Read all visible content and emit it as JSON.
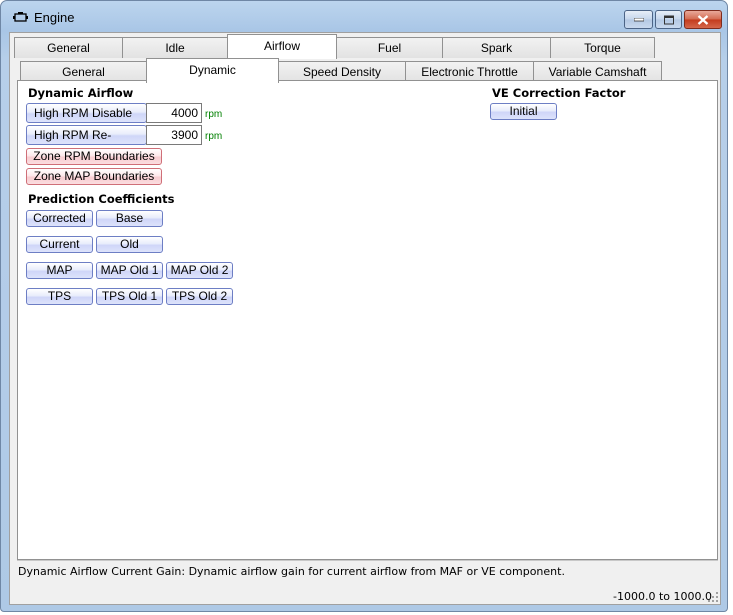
{
  "window": {
    "title": "Engine",
    "icon": "engine-icon"
  },
  "main_tabs": [
    {
      "label": "General",
      "selected": false
    },
    {
      "label": "Idle",
      "selected": false
    },
    {
      "label": "Airflow",
      "selected": true
    },
    {
      "label": "Fuel",
      "selected": false
    },
    {
      "label": "Spark",
      "selected": false
    },
    {
      "label": "Torque Management",
      "selected": false
    }
  ],
  "sub_tabs": [
    {
      "label": "General",
      "selected": false
    },
    {
      "label": "Dynamic",
      "selected": true
    },
    {
      "label": "Speed Density",
      "selected": false
    },
    {
      "label": "Electronic Throttle",
      "selected": false
    },
    {
      "label": "Variable Camshaft",
      "selected": false
    }
  ],
  "dynamic_airflow": {
    "title": "Dynamic Airflow",
    "high_rpm_disable": {
      "label": "High RPM Disable",
      "value": "4000",
      "unit": "rpm"
    },
    "high_rpm_reenable": {
      "label": "High RPM Re-enable",
      "value": "3900",
      "unit": "rpm"
    },
    "zone_rpm_boundaries": "Zone RPM Boundaries",
    "zone_map_boundaries": "Zone MAP Boundaries"
  },
  "prediction_coefficients": {
    "title": "Prediction Coefficients",
    "corrected": "Corrected",
    "base": "Base",
    "current": "Current",
    "old": "Old",
    "map": "MAP",
    "map_old_1": "MAP Old 1",
    "map_old_2": "MAP Old 2",
    "tps": "TPS",
    "tps_old_1": "TPS Old 1",
    "tps_old_2": "TPS Old 2"
  },
  "ve_correction": {
    "title": "VE Correction Factor",
    "initial": "Initial"
  },
  "status": {
    "description": "Dynamic Airflow Current Gain: Dynamic airflow gain for current airflow from MAF or VE component.",
    "range": "-1000.0 to 1000.0"
  },
  "colors": {
    "unit_text": "#008000",
    "button_border": "#6d7ec4",
    "zone_button_border": "#cf6f78"
  }
}
